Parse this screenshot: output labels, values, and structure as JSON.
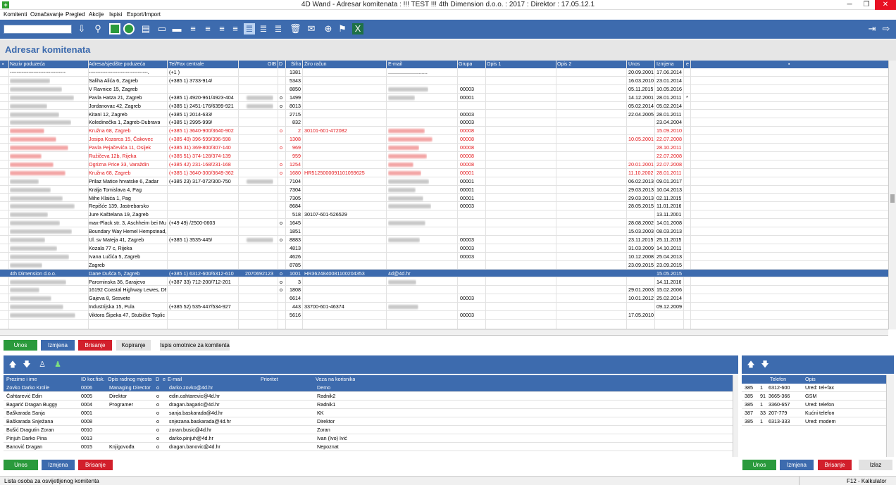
{
  "window": {
    "title": "4D Wand - Adresar komitenata : !!! TEST !!! 4th Dimension d.o.o. : 2017 : Direktor : 17.05.12.1",
    "icon_letter": "+",
    "min": "─",
    "restore": "❐",
    "close": "✕"
  },
  "menu": [
    "Komitenti",
    "Označavanje",
    "Pregled",
    "Akcije",
    "Ispisi",
    "Export/Import"
  ],
  "page_title": "Adresar komitenata",
  "main_table": {
    "headers": [
      "▪",
      "Naziv poduzeća",
      "Adresa/sjedište poduzeća",
      "Tel/Fax centrale",
      "OIB",
      "D",
      "Šifra",
      "Žiro račun",
      "E-mail",
      "Grupa",
      "Opis 1",
      "Opis 2",
      "Unos",
      "Izmjena",
      "e",
      "▪"
    ],
    "rows": [
      {
        "naziv": "---------------------------------",
        "adresa": "-----------------------------------.",
        "tel": "(+1 )",
        "oib": "",
        "d": "",
        "sifra": "1381",
        "ziro": "",
        "email": "............................",
        "grupa": "",
        "unos": "20.09.2001",
        "izmjena": "17.06.2014",
        "e": "",
        "style": "normal",
        "blur_name": false,
        "blur_oib": false,
        "blur_email": false
      },
      {
        "naziv": "",
        "adresa": "Saliha Alića 6, Zagreb",
        "tel": "(+385 1) 3733-914/",
        "oib": "",
        "d": "",
        "sifra": "5343",
        "ziro": "",
        "email": "",
        "grupa": "",
        "unos": "16.03.2010",
        "izmjena": "23.01.2014",
        "e": "",
        "style": "normal",
        "blur_name": true,
        "blur_oib": false,
        "blur_email": false
      },
      {
        "naziv": "",
        "adresa": "V Ravnice 15, Zagreb",
        "tel": "",
        "oib": "",
        "d": "",
        "sifra": "8850",
        "ziro": "",
        "email": "",
        "grupa": "00003",
        "unos": "05.11.2015",
        "izmjena": "10.05.2016",
        "e": "",
        "style": "normal",
        "blur_name": true,
        "blur_oib": false,
        "blur_email": true
      },
      {
        "naziv": "",
        "adresa": "Pavla Hatza 21, Zagreb",
        "tel": "(+385 1) 4920-961/4923-404",
        "oib": "",
        "d": "o",
        "sifra": "1499",
        "ziro": "",
        "email": "",
        "grupa": "00001",
        "unos": "14.12.2001",
        "izmjena": "28.01.2011",
        "e": "*",
        "style": "normal",
        "blur_name": true,
        "blur_oib": true,
        "blur_email": true
      },
      {
        "naziv": "",
        "adresa": "Jordanovac 42, Zagreb",
        "tel": "(+385 1) 2451-176/6399-921",
        "oib": "",
        "d": "o",
        "sifra": "8013",
        "ziro": "",
        "email": "",
        "grupa": "",
        "unos": "05.02.2014",
        "izmjena": "05.02.2014",
        "e": "",
        "style": "normal",
        "blur_name": true,
        "blur_oib": true,
        "blur_email": false
      },
      {
        "naziv": "",
        "adresa": "Kitani 12, Zagreb",
        "tel": "(+385 1) 2014-633/",
        "oib": "",
        "d": "",
        "sifra": "2715",
        "ziro": "",
        "email": "",
        "grupa": "00003",
        "unos": "22.04.2005",
        "izmjena": "28.01.2011",
        "e": "",
        "style": "normal",
        "blur_name": true,
        "blur_oib": false,
        "blur_email": false
      },
      {
        "naziv": "",
        "adresa": "Koledinečka 1, Zagreb-Dubrava",
        "tel": "(+385 1) 2995-999/",
        "oib": "",
        "d": "",
        "sifra": "832",
        "ziro": "",
        "email": "",
        "grupa": "00003",
        "unos": "",
        "izmjena": "23.04.2004",
        "e": "",
        "style": "normal",
        "blur_name": true,
        "blur_oib": false,
        "blur_email": false
      },
      {
        "naziv": "",
        "adresa": "Kružna 68, Zagreb",
        "tel": "(+385 1) 3640-900/3640-902",
        "oib": "",
        "d": "o",
        "sifra": "2",
        "ziro": "30101-601-472082",
        "email": "",
        "grupa": "00008",
        "unos": "",
        "izmjena": "15.09.2010",
        "e": "",
        "style": "red",
        "blur_name": true,
        "blur_oib": false,
        "blur_email": true
      },
      {
        "naziv": "",
        "adresa": "Josipa Kozarca 15, Čakovec",
        "tel": "(+385 40) 396-599/396-598",
        "oib": "",
        "d": "",
        "sifra": "1308",
        "ziro": "",
        "email": "",
        "grupa": "00008",
        "unos": "10.05.2001",
        "izmjena": "22.07.2008",
        "e": "",
        "style": "red",
        "blur_name": true,
        "blur_oib": false,
        "blur_email": true
      },
      {
        "naziv": "",
        "adresa": "Pavla Pejačevića 11, Osijek",
        "tel": "(+385 31) 369-800/307-140",
        "oib": "",
        "d": "o",
        "sifra": "969",
        "ziro": "",
        "email": "",
        "grupa": "00008",
        "unos": "",
        "izmjena": "28.10.2011",
        "e": "",
        "style": "red",
        "blur_name": true,
        "blur_oib": false,
        "blur_email": true
      },
      {
        "naziv": "",
        "adresa": "Ružičeva 12b, Rijeka",
        "tel": "(+385 51) 374-128/374-139",
        "oib": "",
        "d": "",
        "sifra": "959",
        "ziro": "",
        "email": "",
        "grupa": "00008",
        "unos": "",
        "izmjena": "22.07.2008",
        "e": "",
        "style": "red",
        "blur_name": true,
        "blur_oib": false,
        "blur_email": true
      },
      {
        "naziv": "",
        "adresa": "Ogrizna Price 33, Varaždin",
        "tel": "(+385 42) 231-168/231-168",
        "oib": "",
        "d": "o",
        "sifra": "1254",
        "ziro": "",
        "email": "",
        "grupa": "00008",
        "unos": "20.01.2001",
        "izmjena": "22.07.2008",
        "e": "",
        "style": "red",
        "blur_name": true,
        "blur_oib": false,
        "blur_email": true
      },
      {
        "naziv": "",
        "adresa": "Kružna 68, Zagreb",
        "tel": "(+385 1) 3640-300/3649-362",
        "oib": "",
        "d": "o",
        "sifra": "1680",
        "ziro": "HR5125000091101059625",
        "email": "",
        "grupa": "00001",
        "unos": "11.10.2002",
        "izmjena": "28.01.2011",
        "e": "",
        "style": "red",
        "blur_name": true,
        "blur_oib": false,
        "blur_email": true
      },
      {
        "naziv": "",
        "adresa": "Prilaz Matice hrvatske 6, Zadar",
        "tel": "(+385 23) 317-072/300-750",
        "oib": "",
        "d": "",
        "sifra": "7104",
        "ziro": "",
        "email": "",
        "grupa": "00001",
        "unos": "06.02.2013",
        "izmjena": "09.01.2017",
        "e": "",
        "style": "normal",
        "blur_name": true,
        "blur_oib": true,
        "blur_email": true
      },
      {
        "naziv": "",
        "adresa": "Kralja Tomislava 4, Pag",
        "tel": "",
        "oib": "",
        "d": "",
        "sifra": "7304",
        "ziro": "",
        "email": "",
        "grupa": "00001",
        "unos": "29.03.2013",
        "izmjena": "10.04.2013",
        "e": "",
        "style": "normal",
        "blur_name": true,
        "blur_oib": false,
        "blur_email": true
      },
      {
        "naziv": "",
        "adresa": "Mihe Klaića 1, Pag",
        "tel": "",
        "oib": "",
        "d": "",
        "sifra": "7305",
        "ziro": "",
        "email": "",
        "grupa": "00001",
        "unos": "29.03.2013",
        "izmjena": "02.11.2015",
        "e": "",
        "style": "normal",
        "blur_name": true,
        "blur_oib": false,
        "blur_email": true
      },
      {
        "naziv": "",
        "adresa": "Repišće 139, Jastrebarsko",
        "tel": "",
        "oib": "",
        "d": "",
        "sifra": "8684",
        "ziro": "",
        "email": "",
        "grupa": "00003",
        "unos": "28.05.2015",
        "izmjena": "11.01.2016",
        "e": "",
        "style": "normal",
        "blur_name": true,
        "blur_oib": false,
        "blur_email": true
      },
      {
        "naziv": "",
        "adresa": "Jure Kaštelana 19, Zagreb",
        "tel": "",
        "oib": "",
        "d": "",
        "sifra": "518",
        "ziro": "30107-601-526529",
        "email": "",
        "grupa": "",
        "unos": "",
        "izmjena": "13.11.2001",
        "e": "",
        "style": "normal",
        "blur_name": true,
        "blur_oib": false,
        "blur_email": false
      },
      {
        "naziv": "",
        "adresa": "max-Plack str. 3, Aschheim bei Mur",
        "tel": "(+49 49) /2500-0603",
        "oib": "",
        "d": "o",
        "sifra": "1645",
        "ziro": "",
        "email": "",
        "grupa": "",
        "unos": "28.08.2002",
        "izmjena": "14.01.2008",
        "e": "",
        "style": "normal",
        "blur_name": true,
        "blur_oib": false,
        "blur_email": true
      },
      {
        "naziv": "",
        "adresa": "Boundary Way Hemel Hempstead,",
        "tel": "",
        "oib": "",
        "d": "",
        "sifra": "1851",
        "ziro": "",
        "email": "",
        "grupa": "",
        "unos": "15.03.2003",
        "izmjena": "08.03.2013",
        "e": "",
        "style": "normal",
        "blur_name": true,
        "blur_oib": false,
        "blur_email": false
      },
      {
        "naziv": "",
        "adresa": "Ul. sv Mateja 41, Zagreb",
        "tel": "(+385 1) 3535-445/",
        "oib": "",
        "d": "o",
        "sifra": "8883",
        "ziro": "",
        "email": "",
        "grupa": "00003",
        "unos": "23.11.2015",
        "izmjena": "25.11.2015",
        "e": "",
        "style": "normal",
        "blur_name": true,
        "blur_oib": true,
        "blur_email": true
      },
      {
        "naziv": "",
        "adresa": "Kozala 77 c, Rijeka",
        "tel": "",
        "oib": "",
        "d": "",
        "sifra": "4813",
        "ziro": "",
        "email": "",
        "grupa": "00003",
        "unos": "31.03.2009",
        "izmjena": "14.10.2011",
        "e": "",
        "style": "normal",
        "blur_name": true,
        "blur_oib": false,
        "blur_email": false
      },
      {
        "naziv": "",
        "adresa": "Ivana Lučića 5, Zagreb",
        "tel": "",
        "oib": "",
        "d": "",
        "sifra": "4626",
        "ziro": "",
        "email": "",
        "grupa": "00003",
        "unos": "10.12.2008",
        "izmjena": "25.04.2013",
        "e": "",
        "style": "normal",
        "blur_name": true,
        "blur_oib": false,
        "blur_email": false
      },
      {
        "naziv": "",
        "adresa": "Zagreb",
        "tel": "",
        "oib": "",
        "d": "",
        "sifra": "8785",
        "ziro": "",
        "email": "",
        "grupa": "",
        "unos": "23.09.2015",
        "izmjena": "23.09.2015",
        "e": "",
        "style": "normal",
        "blur_name": true,
        "blur_oib": false,
        "blur_email": false
      },
      {
        "naziv": "4th Dimension d.o.o.",
        "adresa": "Dane Dušća 5, Zagreb",
        "tel": "(+385 1) 6312-600/6312-610",
        "oib": "20706921230",
        "d": "o",
        "sifra": "1001",
        "ziro": "HR3624840081100204353",
        "email": "4d@4d.hr",
        "grupa": "",
        "unos": "",
        "izmjena": "15.05.2015",
        "e": "",
        "style": "sel",
        "blur_name": false,
        "blur_oib": false,
        "blur_email": false
      },
      {
        "naziv": "",
        "adresa": "Parominska 36, Sarajevo",
        "tel": "(+387 33) 712-200/712-201",
        "oib": "",
        "d": "o",
        "sifra": "3",
        "ziro": "",
        "email": "",
        "grupa": "",
        "unos": "",
        "izmjena": "14.11.2016",
        "e": "",
        "style": "normal",
        "blur_name": true,
        "blur_oib": false,
        "blur_email": true
      },
      {
        "naziv": "",
        "adresa": "16192 Coastal Highway Lewes, DE",
        "tel": "",
        "oib": "",
        "d": "o",
        "sifra": "1808",
        "ziro": "",
        "email": "",
        "grupa": "",
        "unos": "29.01.2003",
        "izmjena": "15.02.2006",
        "e": "",
        "style": "normal",
        "blur_name": true,
        "blur_oib": false,
        "blur_email": false
      },
      {
        "naziv": "",
        "adresa": "Gajeva 8, Sesvete",
        "tel": "",
        "oib": "",
        "d": "",
        "sifra": "6614",
        "ziro": "",
        "email": "",
        "grupa": "00003",
        "unos": "10.01.2012",
        "izmjena": "25.02.2014",
        "e": "",
        "style": "normal",
        "blur_name": true,
        "blur_oib": false,
        "blur_email": false
      },
      {
        "naziv": "",
        "adresa": "Industrijska 15, Pula",
        "tel": "(+385 52) 535-447/534-927",
        "oib": "",
        "d": "",
        "sifra": "443",
        "ziro": "33700-601-46374",
        "email": "",
        "grupa": "",
        "unos": "",
        "izmjena": "09.12.2009",
        "e": "",
        "style": "normal",
        "blur_name": true,
        "blur_oib": false,
        "blur_email": true
      },
      {
        "naziv": "",
        "adresa": "Viktora Šipeka 47, Stubičke Toplic",
        "tel": "",
        "oib": "",
        "d": "",
        "sifra": "5616",
        "ziro": "",
        "email": "",
        "grupa": "00003",
        "unos": "17.05.2010",
        "izmjena": "",
        "e": "",
        "style": "normal",
        "blur_name": true,
        "blur_oib": false,
        "blur_email": false
      }
    ]
  },
  "main_buttons": {
    "unos": "Unos",
    "izmjena": "Izmjena",
    "brisanje": "Brisanje",
    "kopiranje": "Kopiranje",
    "ispis": "Ispis omotnice za komitenta"
  },
  "persons": {
    "headers": [
      "Prezime i ime",
      "ID kor.fisk.",
      "Opis radnog mjesta",
      "D",
      "e",
      "E-mail",
      "Prioritet",
      "Veza na korisnika"
    ],
    "rows": [
      {
        "ime": "Zovko Darko Krolle",
        "id": "0006",
        "opis": "Managing Director",
        "d": "o",
        "email": "darko.zovko@4d.hr",
        "prioritet": "",
        "veza": "Demo",
        "sel": true
      },
      {
        "ime": "Čahtarević Edin",
        "id": "0005",
        "opis": "Direktor",
        "d": "o",
        "email": "edin.cahtarevic@4d.hr",
        "prioritet": "",
        "veza": "Radnik2",
        "sel": false
      },
      {
        "ime": "Bagarić Dragan Buggy",
        "id": "0004",
        "opis": "Programer",
        "d": "o",
        "email": "dragan.bagaric@4d.hr",
        "prioritet": "",
        "veza": "Radnik1",
        "sel": false
      },
      {
        "ime": "Baškarada Sanja",
        "id": "0001",
        "opis": "",
        "d": "o",
        "email": "sanja.baskarada@4d.hr",
        "prioritet": "",
        "veza": "KK",
        "sel": false
      },
      {
        "ime": "Baškarada Snježana",
        "id": "0008",
        "opis": "",
        "d": "o",
        "email": "snjezana.baskarada@4d.hr",
        "prioritet": "",
        "veza": "Direktor",
        "sel": false
      },
      {
        "ime": "Bušić Dragutin Zoran",
        "id": "0010",
        "opis": "",
        "d": "o",
        "email": "zoran.busic@4d.hr",
        "prioritet": "",
        "veza": "Zoran",
        "sel": false
      },
      {
        "ime": "Pinjuh Darko Pina",
        "id": "0013",
        "opis": "",
        "d": "o",
        "email": "darko.pinjuh@4d.hr",
        "prioritet": "",
        "veza": "Ivan (Ivo) Ivić",
        "sel": false
      },
      {
        "ime": "Banović Dragan",
        "id": "0015",
        "opis": "Knjigovođa",
        "d": "o",
        "email": "dragan.banovic@4d.hr",
        "prioritet": "",
        "veza": "Nepoznat",
        "sel": false
      }
    ],
    "buttons": {
      "unos": "Unos",
      "izmjena": "Izmjena",
      "brisanje": "Brisanje"
    }
  },
  "phones": {
    "headers": [
      "Telefon",
      "Opis"
    ],
    "rows": [
      {
        "a": "385",
        "b": "1",
        "num": "6312-600",
        "opis": "Ured: tel+fax"
      },
      {
        "a": "385",
        "b": "91",
        "num": "3665-366",
        "opis": "GSM"
      },
      {
        "a": "385",
        "b": "1",
        "num": "3360-657",
        "opis": "Ured: telefon"
      },
      {
        "a": "387",
        "b": "33",
        "num": "207-779",
        "opis": "Kućni telefon"
      },
      {
        "a": "385",
        "b": "1",
        "num": "6313-333",
        "opis": "Ured: modem"
      }
    ],
    "buttons": {
      "unos": "Unos",
      "izmjena": "Izmjena",
      "brisanje": "Brisanje",
      "izlaz": "Izlaz"
    }
  },
  "status": {
    "left": "Lista osoba za osvijetljenog komitenta",
    "right": "F12 - Kalkulator"
  }
}
